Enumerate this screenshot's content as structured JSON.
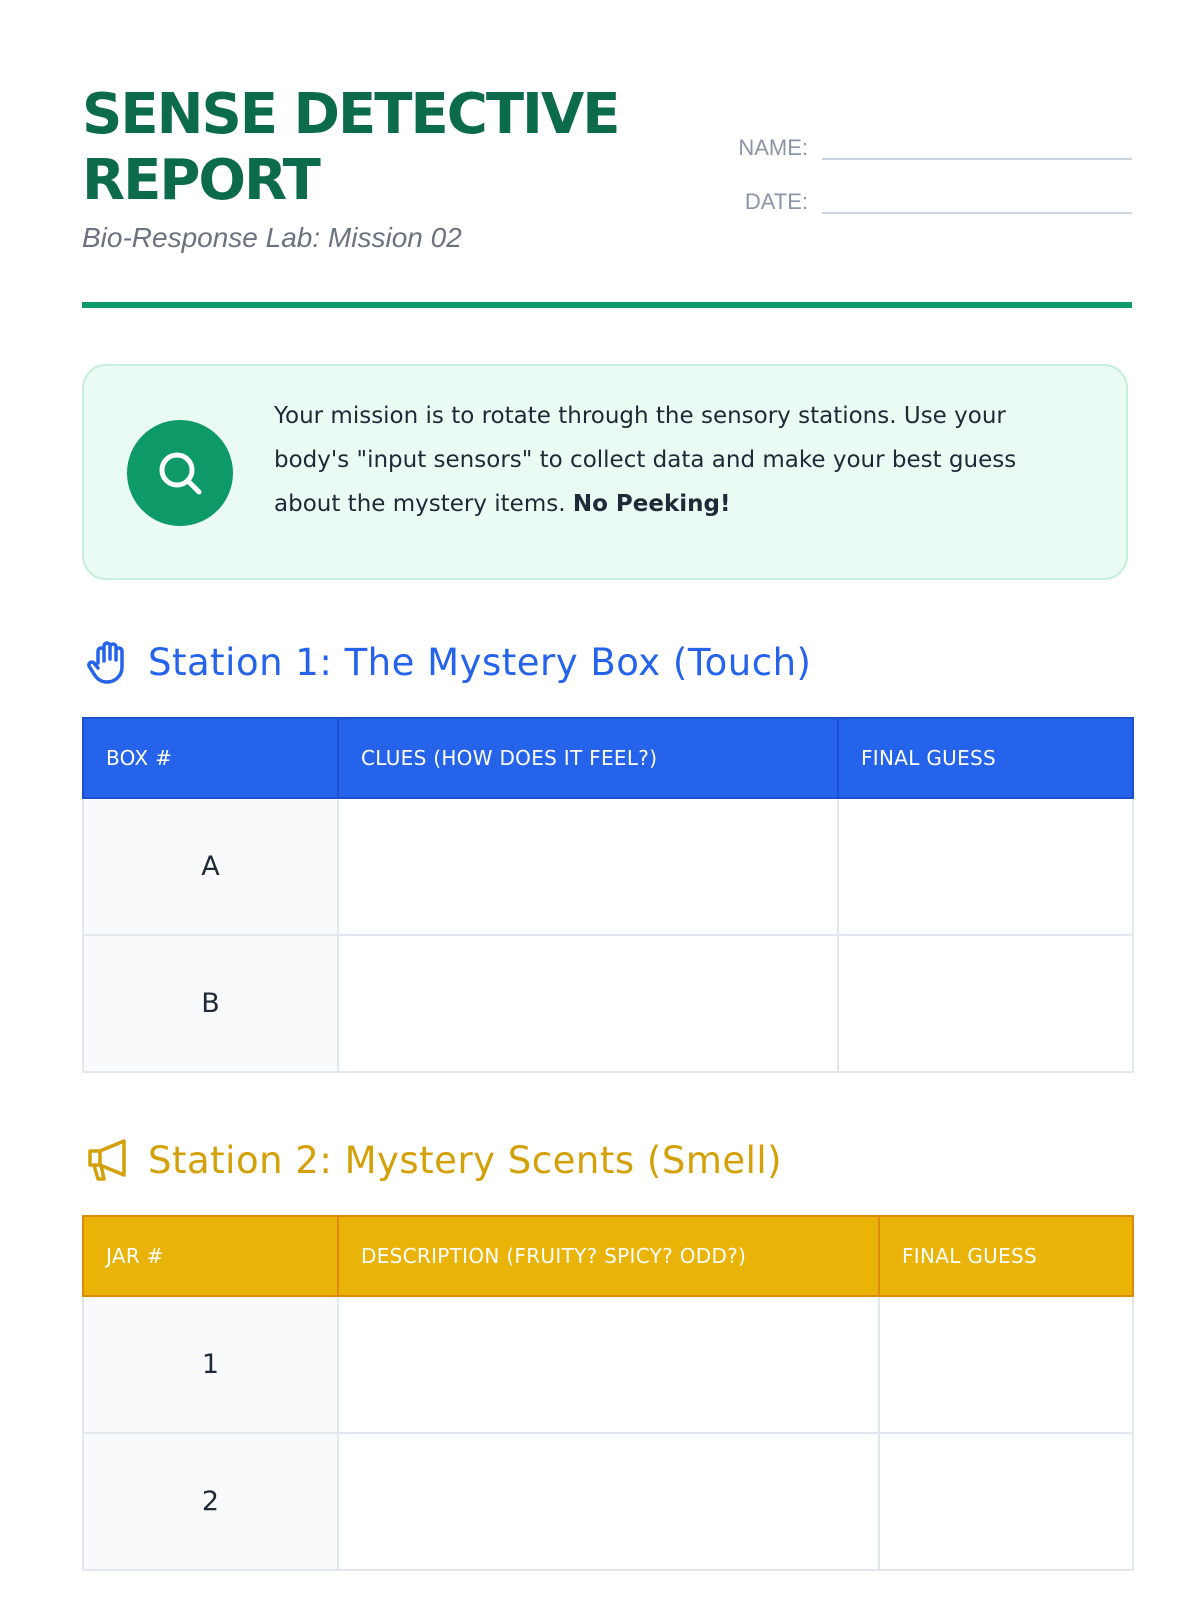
{
  "header": {
    "title": "SENSE DETECTIVE REPORT",
    "subtitle": "Bio-Response Lab: Mission 02",
    "name_label": "NAME:",
    "date_label": "DATE:"
  },
  "mission": {
    "text": "Your mission is to rotate through the sensory stations. Use your body's \"input sensors\" to collect data and make your best guess about the mystery items. ",
    "emphasis": "No Peeking!",
    "icon": "search-icon"
  },
  "colors": {
    "title_green": "#0b6b4a",
    "accent_green": "#0e9a67",
    "station1_blue": "#2563eb",
    "station2_gold": "#eab308"
  },
  "station1": {
    "icon": "hand-icon",
    "heading": "Station 1: The Mystery Box (Touch)",
    "columns": [
      "BOX #",
      "CLUES (HOW DOES IT FEEL?)",
      "FINAL GUESS"
    ],
    "rows": [
      {
        "label": "A"
      },
      {
        "label": "B"
      }
    ]
  },
  "station2": {
    "icon": "megaphone-icon",
    "heading": "Station 2: Mystery Scents (Smell)",
    "columns": [
      "JAR #",
      "DESCRIPTION (FRUITY? SPICY? ODD?)",
      "FINAL GUESS"
    ],
    "rows": [
      {
        "label": "1"
      },
      {
        "label": "2"
      }
    ]
  }
}
